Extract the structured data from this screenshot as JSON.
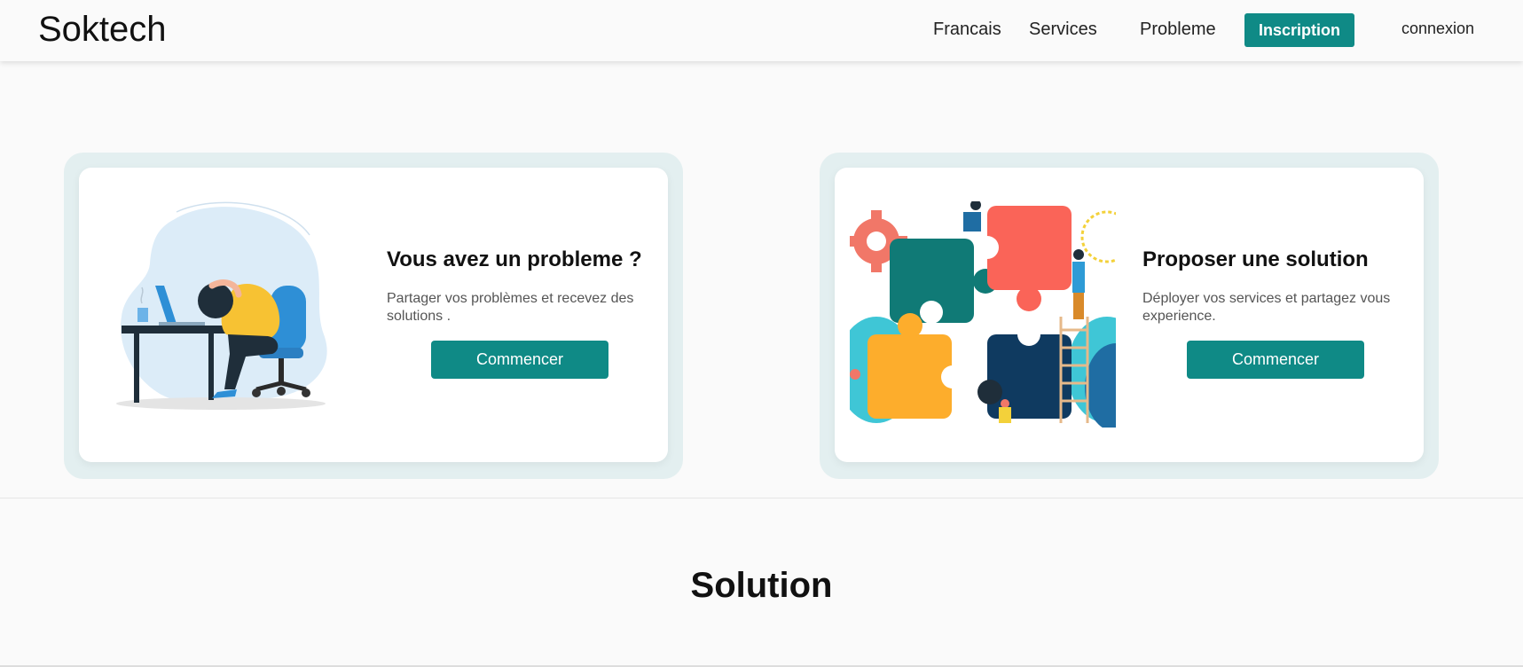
{
  "nav": {
    "logo": "Soktech",
    "links": [
      "Francais",
      "Services",
      "Probleme"
    ],
    "signup": "Inscription",
    "login": "connexion"
  },
  "cards": [
    {
      "title": "Vous avez un probleme ?",
      "text": "Partager vos problèmes et recevez des solutions .",
      "cta": "Commencer",
      "illustration": "stressed-person-at-desk"
    },
    {
      "title": "Proposer une solution",
      "text": "Déployer vos services et partagez vous experience.",
      "cta": "Commencer",
      "illustration": "puzzle-teamwork"
    }
  ],
  "section": {
    "title": "Solution"
  },
  "colors": {
    "accent": "#0f8a86",
    "background": "#fafafa",
    "card_frame": "#e3eff0"
  }
}
